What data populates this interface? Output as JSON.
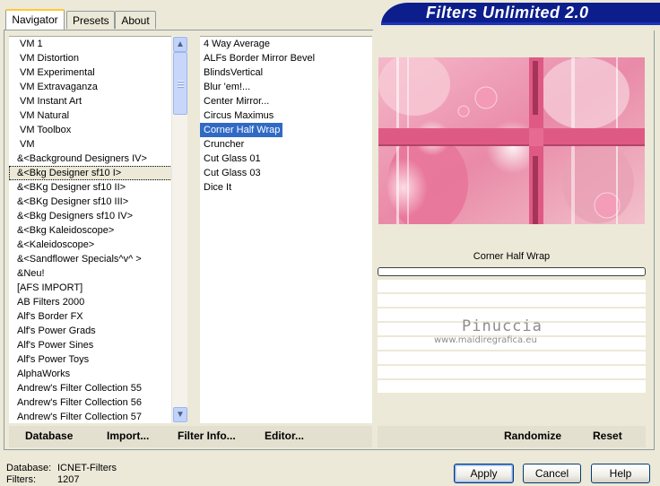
{
  "title": "Filters Unlimited 2.0",
  "tabs": [
    {
      "label": "Navigator",
      "active": true
    },
    {
      "label": "Presets",
      "active": false
    },
    {
      "label": "About",
      "active": false
    }
  ],
  "categories": [
    "VM 1",
    "VM Distortion",
    "VM Experimental",
    "VM Extravaganza",
    "VM Instant Art",
    "VM Natural",
    "VM Toolbox",
    "VM",
    "&<Background Designers IV>",
    "&<Bkg Designer sf10 I>",
    "&<BKg Designer sf10 II>",
    "&<BKg Designer sf10 III>",
    "&<Bkg Designers sf10 IV>",
    "&<Bkg Kaleidoscope>",
    "&<Kaleidoscope>",
    "&<Sandflower Specials^v^ >",
    "&Neu!",
    "[AFS IMPORT]",
    "AB Filters 2000",
    "Alf's Border FX",
    "Alf's Power Grads",
    "Alf's Power Sines",
    "Alf's Power Toys",
    "AlphaWorks",
    "Andrew's Filter Collection 55",
    "Andrew's Filter Collection 56",
    "Andrew's Filter Collection 57"
  ],
  "selected_category": "&<Bkg Designer sf10 I>",
  "filters": [
    "4 Way Average",
    "ALFs Border Mirror Bevel",
    "BlindsVertical",
    "Blur 'em!...",
    "Center Mirror...",
    "Circus Maximus",
    "Corner Half Wrap",
    "Cruncher",
    "Cut Glass 01",
    "Cut Glass 03",
    "Dice It"
  ],
  "selected_filter": "Corner Half Wrap",
  "preview_filter_name": "Corner Half Wrap",
  "watermark": {
    "name": "Pinuccia",
    "url": "www.maidiregrafica.eu"
  },
  "left_buttons": {
    "database": "Database",
    "import": "Import...",
    "filter_info": "Filter Info...",
    "editor": "Editor..."
  },
  "right_buttons": {
    "randomize": "Randomize",
    "reset": "Reset"
  },
  "status": {
    "database_label": "Database:",
    "database_value": "ICNET-Filters",
    "filters_label": "Filters:",
    "filters_value": "1207"
  },
  "dialog_buttons": {
    "apply": "Apply",
    "cancel": "Cancel",
    "help": "Help"
  },
  "colors": {
    "selection": "#316AC5",
    "banner": "#0C1E8C",
    "preview_pink": "#DE5A84"
  }
}
